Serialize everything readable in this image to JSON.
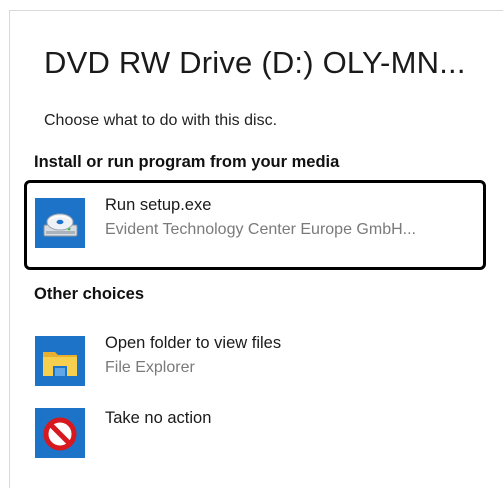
{
  "dialog": {
    "title": "DVD RW Drive (D:) OLY-MN...",
    "prompt": "Choose what to do with this disc."
  },
  "sections": {
    "install": "Install or run program from your media",
    "other": "Other choices"
  },
  "choices": [
    {
      "title": "Run setup.exe",
      "subtitle": "Evident Technology Center Europe GmbH...",
      "icon": "disc-drive-icon",
      "selected": true
    },
    {
      "title": "Open folder to view files",
      "subtitle": "File Explorer",
      "icon": "folder-icon",
      "selected": false
    },
    {
      "title": "Take no action",
      "subtitle": "",
      "icon": "no-action-icon",
      "selected": false
    }
  ],
  "colors": {
    "icon_background": "#1d73c7",
    "selection_border": "#000000",
    "subtitle_text": "#7a7a7a"
  }
}
